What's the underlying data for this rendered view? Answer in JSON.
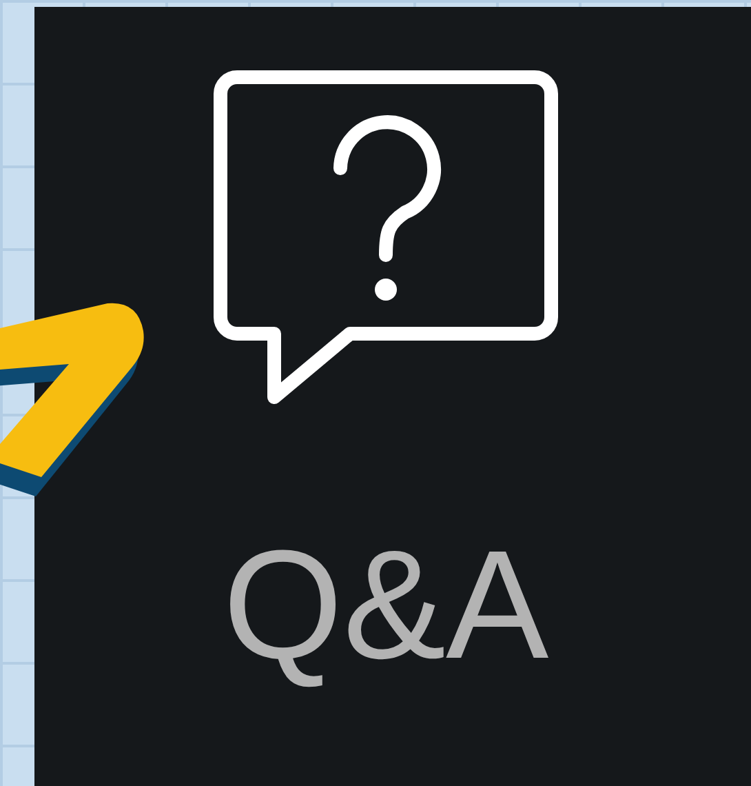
{
  "qa_button": {
    "label": "Q&A"
  }
}
